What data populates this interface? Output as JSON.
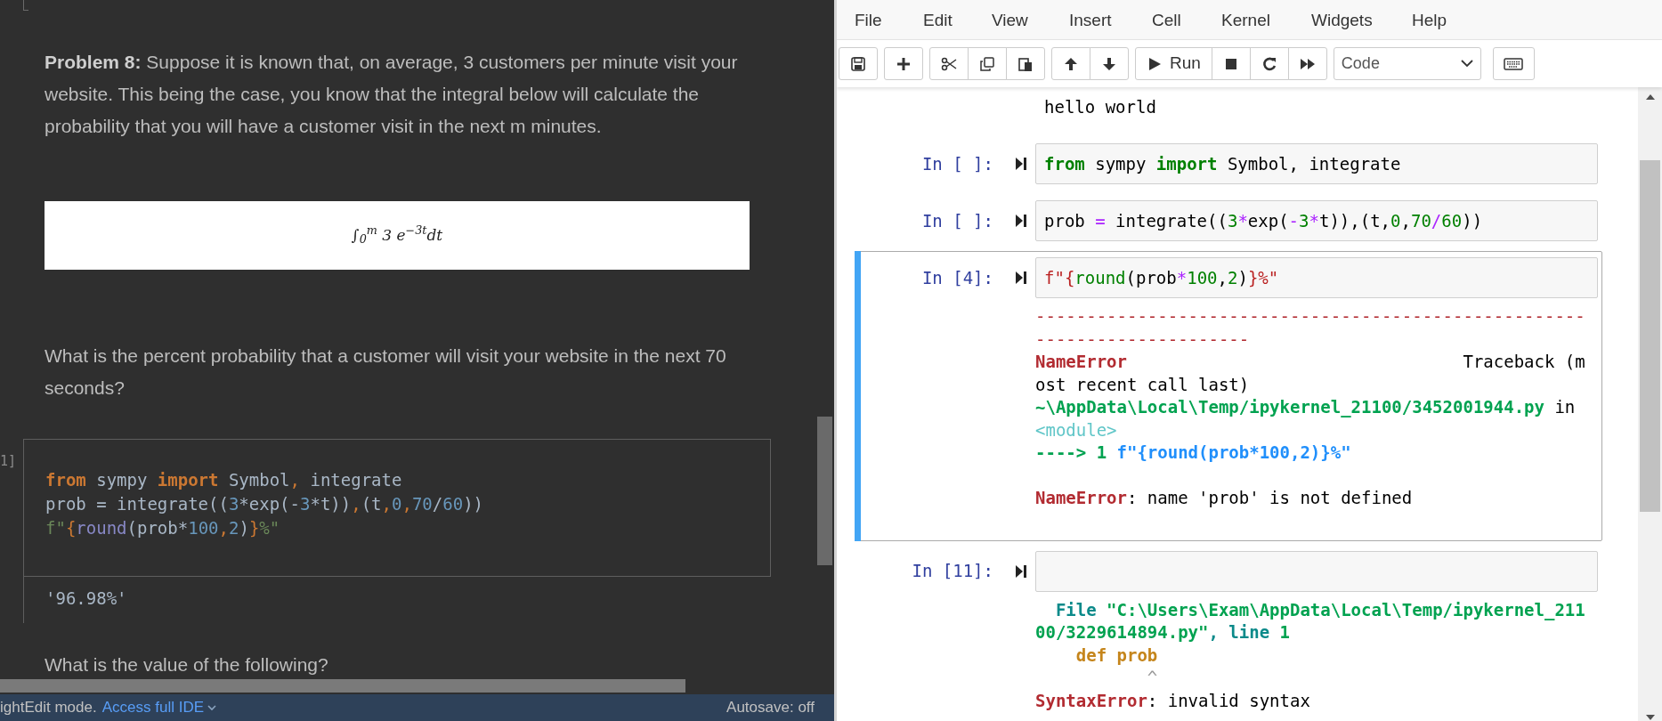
{
  "editor": {
    "problem": "**Problem 8:** Suppose it is known that, on average, 3 customers per minute visit your website. This being the case, you know that the integral below will calculate the probability that you will have a customer visit in the next m minutes.",
    "formula": "∫$_{0}$$^{m}$ 3 e$^{−3t}$dt",
    "question": "What is the percent probability that a customer will visit your website in the next 70 seconds?",
    "code_cell": {
      "prompt": "1]",
      "lines": [
        [
          {
            "kind": "kw",
            "text": "from"
          },
          {
            "kind": "name",
            "text": " sympy "
          },
          {
            "kind": "kw",
            "text": "import"
          },
          {
            "kind": "name",
            "text": " Symbol"
          },
          {
            "kind": "punct",
            "text": ","
          },
          {
            "kind": "name",
            "text": " integrate"
          }
        ],
        [
          {
            "kind": "name",
            "text": "prob = integrate(("
          },
          {
            "kind": "num",
            "text": "3"
          },
          {
            "kind": "name",
            "text": "*exp(-"
          },
          {
            "kind": "num",
            "text": "3"
          },
          {
            "kind": "name",
            "text": "*t))"
          },
          {
            "kind": "punct",
            "text": ","
          },
          {
            "kind": "name",
            "text": "(t"
          },
          {
            "kind": "punct",
            "text": ","
          },
          {
            "kind": "num",
            "text": "0"
          },
          {
            "kind": "punct",
            "text": ","
          },
          {
            "kind": "num",
            "text": "70"
          },
          {
            "kind": "name",
            "text": "/"
          },
          {
            "kind": "num",
            "text": "60"
          },
          {
            "kind": "name",
            "text": "))"
          }
        ],
        [
          {
            "kind": "str",
            "text": "f\""
          },
          {
            "kind": "punct",
            "text": "{"
          },
          {
            "kind": "builtin",
            "text": "round"
          },
          {
            "kind": "name",
            "text": "(prob*"
          },
          {
            "kind": "num",
            "text": "100"
          },
          {
            "kind": "punct",
            "text": ","
          },
          {
            "kind": "num",
            "text": "2"
          },
          {
            "kind": "name",
            "text": ")"
          },
          {
            "kind": "punct",
            "text": "}"
          },
          {
            "kind": "str",
            "text": "%\""
          }
        ]
      ],
      "output": "'96.98%'"
    },
    "next_text": "What is the value of the following?",
    "status_bar": {
      "mode": "ightEdit mode.",
      "link": "Access full IDE",
      "autosave": "Autosave: off"
    }
  },
  "notebook": {
    "menu": [
      "File",
      "Edit",
      "View",
      "Insert",
      "Cell",
      "Kernel",
      "Widgets",
      "Help"
    ],
    "toolbar": [
      [
        {
          "kind": "save"
        }
      ],
      [
        {
          "kind": "add"
        }
      ],
      [
        {
          "kind": "cut"
        },
        {
          "kind": "copy"
        },
        {
          "kind": "paste"
        }
      ],
      [
        {
          "kind": "up"
        },
        {
          "kind": "down"
        }
      ],
      [
        {
          "kind": "run",
          "label": "Run"
        },
        {
          "kind": "stop"
        },
        {
          "kind": "restart"
        },
        {
          "kind": "forward"
        }
      ]
    ],
    "cell_type": "Code",
    "top_output": "hello world",
    "cells": [
      {
        "prompt": "In [ ]:",
        "selected": false,
        "lines": [
          [
            {
              "kind": "kw",
              "text": "from"
            },
            {
              "kind": "name",
              "text": " sympy "
            },
            {
              "kind": "kw",
              "text": "import"
            },
            {
              "kind": "name",
              "text": " Symbol, integrate"
            }
          ]
        ]
      },
      {
        "prompt": "In [ ]:",
        "selected": false,
        "lines": [
          [
            {
              "kind": "name",
              "text": "prob "
            },
            {
              "kind": "op",
              "text": "="
            },
            {
              "kind": "name",
              "text": " integrate(("
            },
            {
              "kind": "num",
              "text": "3"
            },
            {
              "kind": "op",
              "text": "*"
            },
            {
              "kind": "name",
              "text": "exp("
            },
            {
              "kind": "op",
              "text": "-"
            },
            {
              "kind": "num",
              "text": "3"
            },
            {
              "kind": "op",
              "text": "*"
            },
            {
              "kind": "name",
              "text": "t)),(t,"
            },
            {
              "kind": "num",
              "text": "0"
            },
            {
              "kind": "name",
              "text": ","
            },
            {
              "kind": "num",
              "text": "70"
            },
            {
              "kind": "op",
              "text": "/"
            },
            {
              "kind": "num",
              "text": "60"
            },
            {
              "kind": "name",
              "text": "))"
            }
          ]
        ]
      },
      {
        "prompt": "In [4]:",
        "selected": true,
        "lines": [
          [
            {
              "kind": "str",
              "text": "f\"{"
            },
            {
              "kind": "builtin",
              "text": "round"
            },
            {
              "kind": "name",
              "text": "(prob"
            },
            {
              "kind": "op",
              "text": "*"
            },
            {
              "kind": "num",
              "text": "100"
            },
            {
              "kind": "name",
              "text": ","
            },
            {
              "kind": "num",
              "text": "2"
            },
            {
              "kind": "name",
              "text": ")"
            },
            {
              "kind": "str",
              "text": "}%\""
            }
          ]
        ],
        "output": [
          [
            [
              {
                "kind": "error",
                "text": "------------------------------------------------------"
              }
            ],
            [
              {
                "kind": "error",
                "text": "---------------------"
              }
            ],
            [
              {
                "kind": "exception",
                "text": "NameError"
              },
              {
                "kind": "text",
                "text": "                                 Traceback (m"
              }
            ],
            [
              {
                "kind": "text",
                "text": "ost recent call last)"
              }
            ],
            [
              {
                "kind": "path",
                "text": "~\\AppData\\Local\\Temp/ipykernel_21100/3452001944.py"
              },
              {
                "kind": "text",
                "text": " in"
              }
            ],
            [
              {
                "kind": "module",
                "text": "<module>"
              }
            ],
            [
              {
                "kind": "arrow",
                "text": "----> 1 "
              },
              {
                "kind": "source",
                "text": "f\"{round(prob*100,2)}%\""
              }
            ]
          ],
          [
            [
              {
                "kind": "exception",
                "text": "NameError"
              },
              {
                "kind": "text",
                "text": ": name 'prob' is not defined"
              }
            ]
          ]
        ]
      },
      {
        "prompt": "In [11]:",
        "selected": false,
        "output": [
          [
            [
              {
                "kind": "file",
                "text": "  File "
              },
              {
                "kind": "path",
                "text": "\"C:\\Users\\Exam\\AppData\\Local\\Temp/ipykernel_211"
              }
            ],
            [
              {
                "kind": "path",
                "text": "00/3229614894.py\""
              },
              {
                "kind": "file",
                "text": ", line "
              },
              {
                "kind": "path",
                "text": "1"
              }
            ],
            [
              {
                "kind": "snippet",
                "text": "    def prob"
              }
            ],
            [
              {
                "kind": "caret",
                "text": "           ^"
              }
            ],
            [
              {
                "kind": "exception",
                "text": "SyntaxError"
              },
              {
                "kind": "text",
                "text": ": invalid syntax"
              }
            ]
          ]
        ]
      }
    ]
  }
}
